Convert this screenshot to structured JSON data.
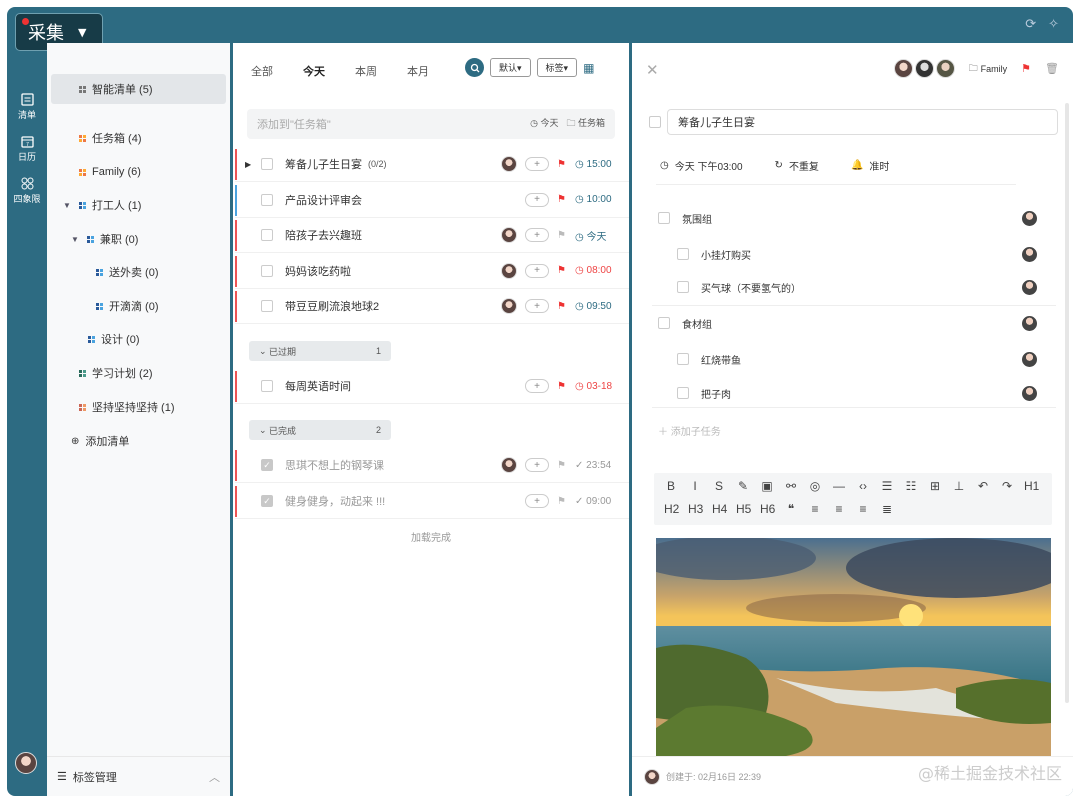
{
  "app": {
    "title": "采集"
  },
  "rail": [
    {
      "label": "清单",
      "icon": "list-icon"
    },
    {
      "label": "日历",
      "icon": "calendar-icon"
    },
    {
      "label": "四象限",
      "icon": "quadrant-icon"
    }
  ],
  "sidebar": {
    "items": [
      {
        "label": "智能清单 (5)"
      },
      {
        "label": "任务箱 (4)"
      },
      {
        "label": "Family (6)"
      },
      {
        "label": "打工人 (1)"
      },
      {
        "label": "兼职 (0)"
      },
      {
        "label": "送外卖 (0)"
      },
      {
        "label": "开滴滴 (0)"
      },
      {
        "label": "设计 (0)"
      },
      {
        "label": "学习计划 (2)"
      },
      {
        "label": "坚持坚持坚持 (1)"
      }
    ],
    "add_list": "添加清单",
    "footer": "标签管理"
  },
  "middle": {
    "tabs": [
      "全部",
      "今天",
      "本周",
      "本月"
    ],
    "selected_tab": "今天",
    "default_dd": "默认▾",
    "tag_dd": "标签▾",
    "add_placeholder": "添加到\"任务箱\"",
    "add_today": "今天",
    "add_box": "任务箱",
    "tasks": [
      {
        "name": "筹备儿子生日宴",
        "count": "(0/2)",
        "time": "15:00",
        "flag": "#e33",
        "time_color": "#2d6b82",
        "bar": "#e55"
      },
      {
        "name": "产品设计评审会",
        "count": "",
        "time": "10:00",
        "flag": "#e33",
        "time_color": "#2d6b82",
        "bar": "#4aa3df"
      },
      {
        "name": "陪孩子去兴趣班",
        "count": "",
        "time": "今天",
        "flag": "#bbb",
        "time_color": "#2d6b82",
        "bar": "#e55"
      },
      {
        "name": "妈妈该吃药啦",
        "count": "",
        "time": "08:00",
        "flag": "#e33",
        "time_color": "#e44",
        "bar": "#e55"
      },
      {
        "name": "带豆豆刷流浪地球2",
        "count": "",
        "time": "09:50",
        "flag": "#e33",
        "time_color": "#2d6b82",
        "bar": "#e55"
      }
    ],
    "overdue": {
      "label": "已过期",
      "count": "1",
      "task": {
        "name": "每周英语时间",
        "time": "03-18",
        "flag": "#e33",
        "time_color": "#e44"
      }
    },
    "done": {
      "label": "已完成",
      "count": "2",
      "tasks": [
        {
          "name": "思琪不想上的钢琴课",
          "time": "23:54"
        },
        {
          "name": "健身健身，动起来 !!!",
          "time": "09:00"
        }
      ]
    },
    "loaded": "加载完成"
  },
  "detail": {
    "folder": "Family",
    "title": "筹备儿子生日宴",
    "date": "今天 下午03:00",
    "repeat": "不重复",
    "reminder": "准时",
    "subtasks": [
      {
        "name": "氛围组",
        "level": 0
      },
      {
        "name": "小挂灯购买",
        "level": 1
      },
      {
        "name": "买气球（不要氢气的）",
        "level": 1
      },
      {
        "name": "食材组",
        "level": 0
      },
      {
        "name": "红烧带鱼",
        "level": 1
      },
      {
        "name": "把子肉",
        "level": 1
      }
    ],
    "add_subtask": "添加子任务",
    "toolbar_row1": [
      "B",
      "I",
      "S",
      "✎",
      "▣",
      "⚯",
      "◎",
      "—",
      "‹›",
      "☰",
      "☷",
      "⊞",
      "⊥",
      "↶",
      "↷",
      "H1"
    ],
    "toolbar_row2": [
      "H2",
      "H3",
      "H4",
      "H5",
      "H6",
      "❝",
      "≡",
      "≡",
      "≡",
      "≣"
    ],
    "created": "创建于: 02月16日 22:39"
  },
  "watermark": "@稀土掘金技术社区",
  "colors": {
    "frame": "#2d6b82",
    "accent": "#2d6b82",
    "flag_red": "#e33"
  }
}
